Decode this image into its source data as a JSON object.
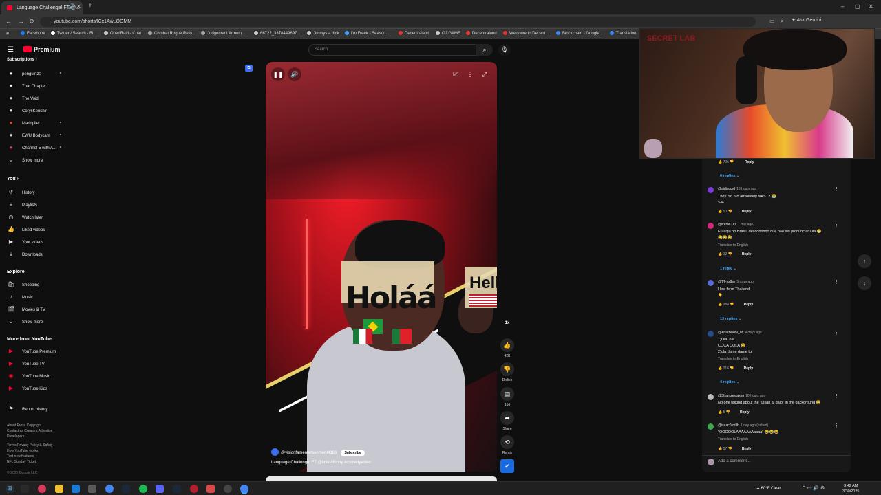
{
  "browser": {
    "tab_title": "Language Challenge! FT @...",
    "url": "youtube.com/shorts/lCx1AwLOOMM",
    "ask_gemini": "Ask Gemini",
    "bookmarks": [
      "Facebook",
      "Twitter / Search - Bi...",
      "OpenRaid - Chat",
      "Combat Rogue Refo...",
      "Judgement Armor (...",
      "66722_3378449697...",
      "Jimmys a dick",
      "I'm Freek - Season...",
      "Decentraland",
      "OJ GAME",
      "Decentraland",
      "Welcome to Decent...",
      "Blockchain - Google...",
      "Translation"
    ]
  },
  "youtube": {
    "logo": "Premium",
    "search_placeholder": "Search"
  },
  "sidebar": {
    "subscriptions_header": "Subscriptions",
    "subscriptions": [
      "penguinz0",
      "That Chapter",
      "The Void",
      "CorysKenshin",
      "Markiplier",
      "EWU Bodycam",
      "Channel 5 with A...",
      "Show more"
    ],
    "you_header": "You",
    "you_items": [
      "History",
      "Playlists",
      "Watch later",
      "Liked videos",
      "Your videos",
      "Downloads"
    ],
    "explore_header": "Explore",
    "explore_items": [
      "Shopping",
      "Music",
      "Movies & TV",
      "Show more"
    ],
    "more_header": "More from YouTube",
    "more_items": [
      "YouTube Premium",
      "YouTube TV",
      "YouTube Music",
      "YouTube Kids"
    ],
    "report_history": "Report history",
    "footer": [
      "About  Press  Copyright",
      "Contact us  Creators  Advertise",
      "Developers",
      "Terms  Privacy  Policy & Safety",
      "How YouTube works",
      "Test new features",
      "NFL Sunday Ticket",
      "© 2025 Google LLC"
    ]
  },
  "video": {
    "overlay_hola": "Holáá",
    "overlay_hello": "Hell",
    "channel": "@visionfamentertainment4186",
    "subscribe": "Subscribe",
    "title": "Language Challenge! FT @tinie  #funny #comedyvideo"
  },
  "actions": {
    "speed": "1x",
    "likes": "42K",
    "dislike": "Dislike",
    "comments": "156",
    "share": "Share",
    "remix": "Remix"
  },
  "webcam": {
    "logo": "SECRET LAB"
  },
  "comments": {
    "top_replies": "6 replies",
    "items": [
      {
        "user": "@aidiscord",
        "time": "13 hours ago",
        "text": "They did bro absolutely NASTY 😭",
        "text2": "SA-",
        "likes": "50",
        "replies": ""
      },
      {
        "user": "@icaroCD.s",
        "time": "1 day ago",
        "text": "Eu aqui no Brasil, descobrindo que não sei pronunciar Olá 😂",
        "text2": "😂😂😂",
        "translate": "Translate to English",
        "likes": "12",
        "replies": "1 reply"
      },
      {
        "user": "@TT-xz9sv",
        "time": "5 days ago",
        "text": "How form Thailand",
        "text2": "👇",
        "likes": "384",
        "replies": "13 replies"
      },
      {
        "user": "@Anarbekov_off",
        "time": "4 days ago",
        "text": "1)Ola, ola",
        "text2": "COCA COLA 😂",
        "text3": "2)ola dame dame tu",
        "translate": "Translate to English",
        "likes": "216",
        "replies": "4 replies"
      },
      {
        "user": "@Shamzestaken",
        "time": "10 hours ago",
        "text": "No one talking about the \"Lisan al gaib\" in the background 😂",
        "likes": "5",
        "replies": ""
      },
      {
        "user": "@isaac0-m9b",
        "time": "1 day ago (edited)",
        "text": "\"OOOOOLAAAAAAAaaaa\" 😂😂😂",
        "translate": "Translate to English",
        "likes": "57",
        "replies": ""
      }
    ],
    "reply_label": "Reply",
    "add_comment": "Add a comment..."
  },
  "taskbar": {
    "weather": "60°F  Clear",
    "time": "3:42 AM",
    "date": "3/30/2025"
  }
}
